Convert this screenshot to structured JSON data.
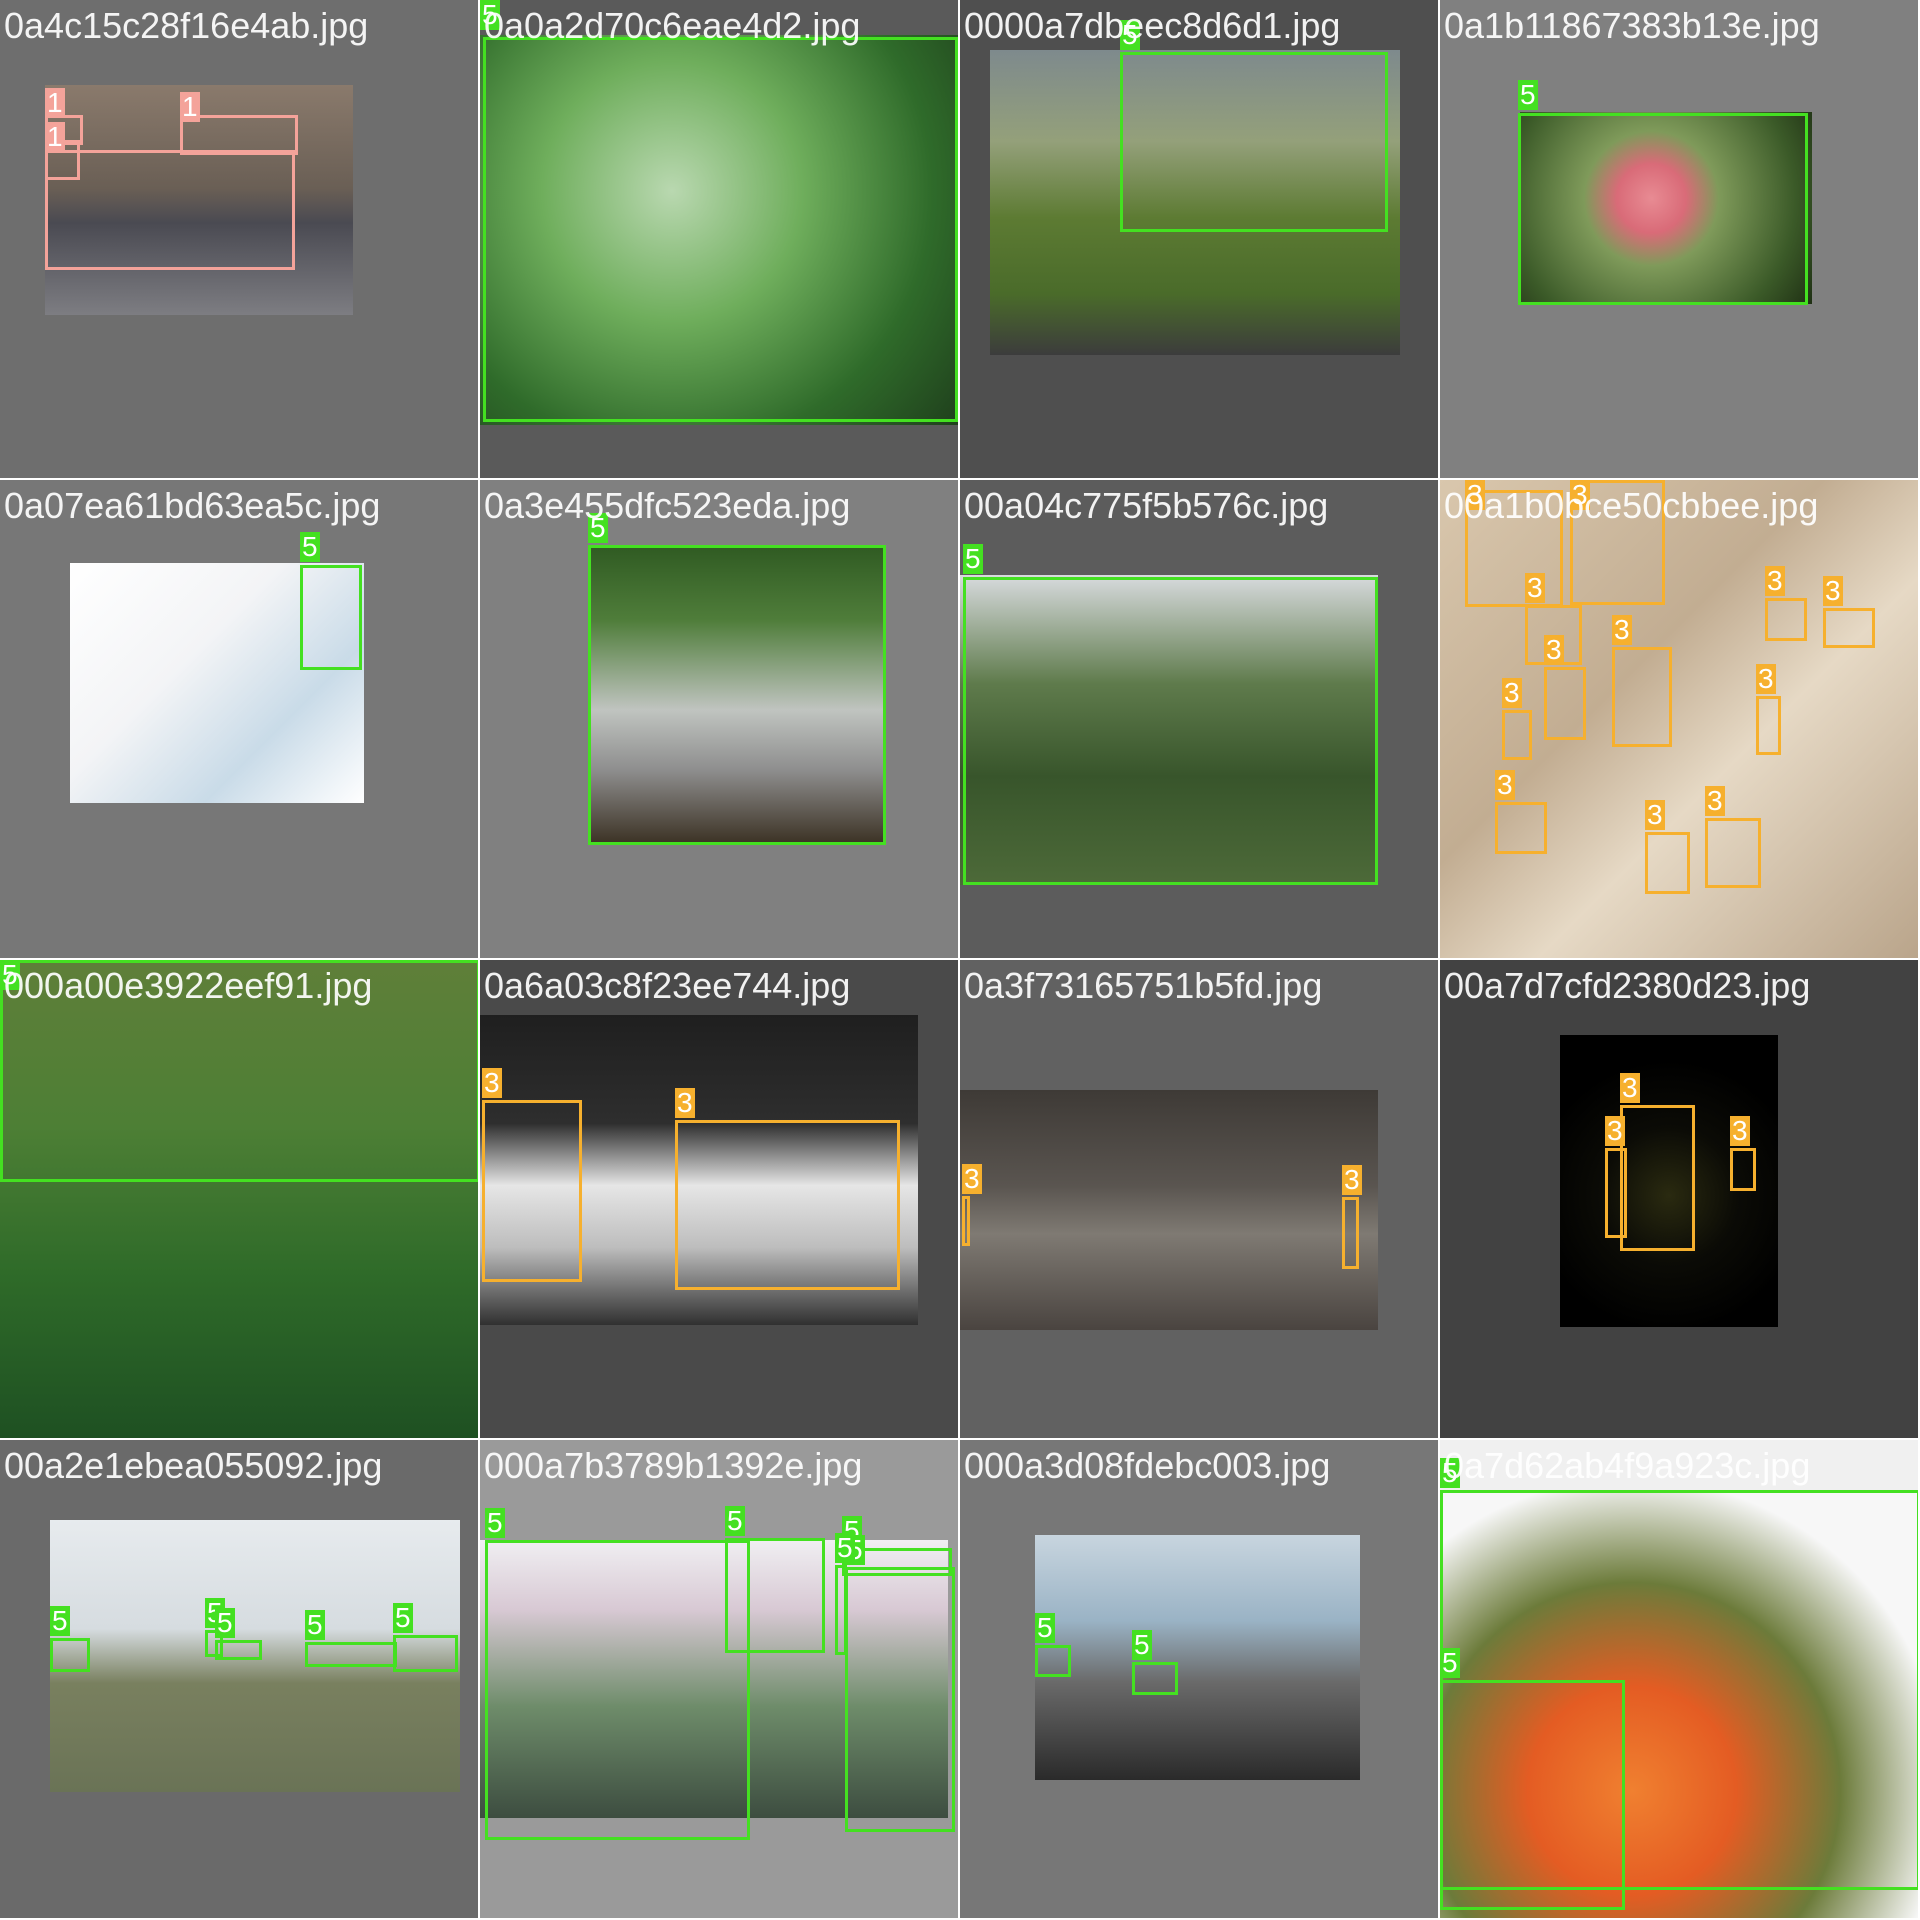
{
  "colors": {
    "class_1": "#f4a39a",
    "class_3": "#f6b02e",
    "class_5": "#44e021"
  },
  "tiles": [
    {
      "name": "0a4c15c28f16e4ab.jpg",
      "bg": "#6e6e6e",
      "boxes": [
        {
          "label": "1",
          "cls": "class_1"
        },
        {
          "label": "1",
          "cls": "class_1"
        },
        {
          "label": "1",
          "cls": "class_1"
        },
        {
          "label": "1",
          "cls": "class_1"
        }
      ]
    },
    {
      "name": "0a0a2d70c6eae4d2.jpg",
      "bg": "#5a5a5a",
      "boxes": [
        {
          "label": "5",
          "cls": "class_5"
        }
      ]
    },
    {
      "name": "0000a7dbeec8d6d1.jpg",
      "bg": "#4f4f4f",
      "boxes": [
        {
          "label": "5",
          "cls": "class_5"
        }
      ]
    },
    {
      "name": "0a1b11867383b13e.jpg",
      "bg": "#808080",
      "boxes": [
        {
          "label": "5",
          "cls": "class_5"
        }
      ]
    },
    {
      "name": "0a07ea61bd63ea5c.jpg",
      "bg": "#777777",
      "boxes": [
        {
          "label": "5",
          "cls": "class_5"
        }
      ]
    },
    {
      "name": "0a3e455dfc523eda.jpg",
      "bg": "#808080",
      "boxes": [
        {
          "label": "5",
          "cls": "class_5"
        }
      ]
    },
    {
      "name": "00a04c775f5b576c.jpg",
      "bg": "#5c5c5c",
      "boxes": [
        {
          "label": "5",
          "cls": "class_5"
        }
      ]
    },
    {
      "name": "00a1b0bce50cbbee.jpg",
      "bg": "#c9b49a",
      "boxes": [
        {
          "label": "3",
          "cls": "class_3"
        },
        {
          "label": "3",
          "cls": "class_3"
        },
        {
          "label": "3",
          "cls": "class_3"
        },
        {
          "label": "3",
          "cls": "class_3"
        },
        {
          "label": "3",
          "cls": "class_3"
        },
        {
          "label": "3",
          "cls": "class_3"
        },
        {
          "label": "3",
          "cls": "class_3"
        },
        {
          "label": "3",
          "cls": "class_3"
        },
        {
          "label": "3",
          "cls": "class_3"
        },
        {
          "label": "3",
          "cls": "class_3"
        },
        {
          "label": "3",
          "cls": "class_3"
        },
        {
          "label": "3",
          "cls": "class_3"
        }
      ]
    },
    {
      "name": "000a00e3922eef91.jpg",
      "bg": "#3d6b2a",
      "boxes": [
        {
          "label": "5",
          "cls": "class_5"
        }
      ]
    },
    {
      "name": "0a6a03c8f23ee744.jpg",
      "bg": "#4a4a4a",
      "boxes": [
        {
          "label": "3",
          "cls": "class_3"
        },
        {
          "label": "3",
          "cls": "class_3"
        }
      ]
    },
    {
      "name": "0a3f73165751b5fd.jpg",
      "bg": "#616161",
      "boxes": [
        {
          "label": "3",
          "cls": "class_3"
        },
        {
          "label": "3",
          "cls": "class_3"
        }
      ]
    },
    {
      "name": "00a7d7cfd2380d23.jpg",
      "bg": "#424242",
      "boxes": [
        {
          "label": "3",
          "cls": "class_3"
        },
        {
          "label": "3",
          "cls": "class_3"
        },
        {
          "label": "3",
          "cls": "class_3"
        }
      ]
    },
    {
      "name": "00a2e1ebea055092.jpg",
      "bg": "#6a6a6a",
      "boxes": [
        {
          "label": "5",
          "cls": "class_5"
        },
        {
          "label": "5",
          "cls": "class_5"
        },
        {
          "label": "5",
          "cls": "class_5"
        },
        {
          "label": "5",
          "cls": "class_5"
        },
        {
          "label": "5",
          "cls": "class_5"
        }
      ]
    },
    {
      "name": "000a7b3789b1392e.jpg",
      "bg": "#9a9a9a",
      "boxes": [
        {
          "label": "5",
          "cls": "class_5"
        },
        {
          "label": "5",
          "cls": "class_5"
        },
        {
          "label": "5",
          "cls": "class_5"
        },
        {
          "label": "5",
          "cls": "class_5"
        },
        {
          "label": "5",
          "cls": "class_5"
        }
      ]
    },
    {
      "name": "000a3d08fdebc003.jpg",
      "bg": "#777777",
      "boxes": [
        {
          "label": "5",
          "cls": "class_5"
        },
        {
          "label": "5",
          "cls": "class_5"
        }
      ]
    },
    {
      "name": "0a7d62ab4f9a923c.jpg",
      "bg": "#f0f0f0",
      "boxes": [
        {
          "label": "5",
          "cls": "class_5"
        },
        {
          "label": "5",
          "cls": "class_5"
        }
      ]
    }
  ]
}
